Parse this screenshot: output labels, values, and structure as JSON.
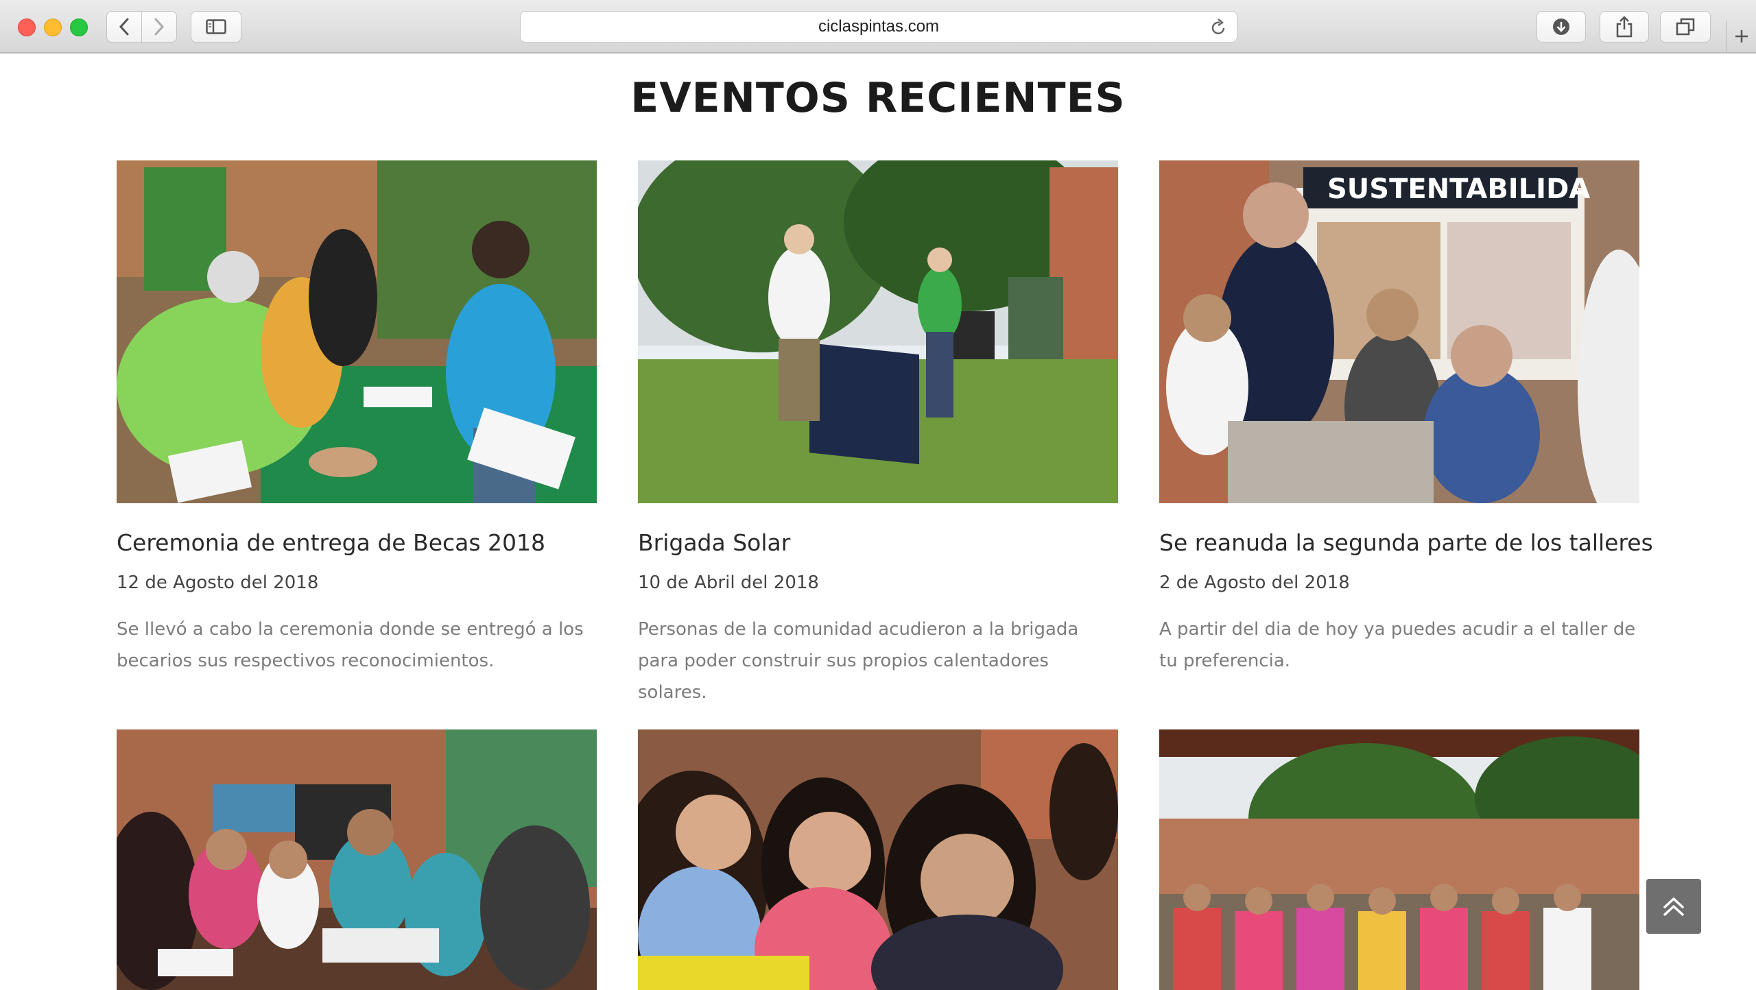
{
  "browser": {
    "url": "ciclaspintas.com"
  },
  "section": {
    "title": "EVENTOS RECIENTES"
  },
  "events": [
    {
      "title": "Ceremonia de entrega de Becas 2018",
      "date": "12 de Agosto del 2018",
      "description": "Se llevó a cabo la ceremonia donde se entregó a los becarios sus respectivos reconocimientos."
    },
    {
      "title": "Brigada Solar",
      "date": "10 de Abril del 2018",
      "description": "Personas de la comunidad acudieron a la brigada para poder construir sus propios calentadores solares."
    },
    {
      "title": "Se reanuda la segunda parte de los talleres",
      "date": "2 de Agosto del 2018",
      "description": "A partir del dia de hoy ya puedes acudir a el taller de tu preferencia."
    }
  ],
  "photo_banner_text": "SUSTENTABILIDA",
  "icons": {
    "back": "chevron-left-icon",
    "forward": "chevron-right-icon",
    "sidebar": "sidebar-icon",
    "reload": "reload-icon",
    "download": "download-icon",
    "share": "share-icon",
    "tabs": "tabs-icon",
    "new_tab": "plus-icon",
    "scroll_top": "double-chevron-up-icon"
  },
  "colors": {
    "title": "#1b1b1b",
    "description": "#7c7c7c",
    "scroll_button": "#6f6f6f"
  }
}
